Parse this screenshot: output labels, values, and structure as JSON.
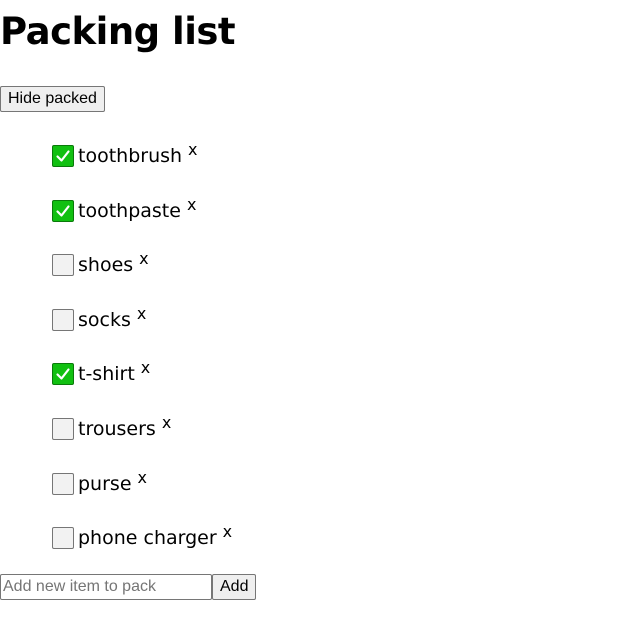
{
  "page": {
    "title": "Packing list"
  },
  "toolbar": {
    "hide_packed_label": "Hide packed"
  },
  "items": [
    {
      "label": "toothbrush",
      "packed": true,
      "remove": "x"
    },
    {
      "label": "toothpaste",
      "packed": true,
      "remove": "x"
    },
    {
      "label": "shoes",
      "packed": false,
      "remove": "x"
    },
    {
      "label": "socks",
      "packed": false,
      "remove": "x"
    },
    {
      "label": "t-shirt",
      "packed": true,
      "remove": "x"
    },
    {
      "label": "trousers",
      "packed": false,
      "remove": "x"
    },
    {
      "label": "purse",
      "packed": false,
      "remove": "x"
    },
    {
      "label": "phone charger",
      "packed": false,
      "remove": "x"
    }
  ],
  "add_form": {
    "input_value": "",
    "input_placeholder": "Add new item to pack",
    "add_label": "Add"
  },
  "colors": {
    "checked_fill": "#11c011",
    "unchecked_fill": "#f2f2f2"
  },
  "icons": {
    "check": "check-icon"
  }
}
